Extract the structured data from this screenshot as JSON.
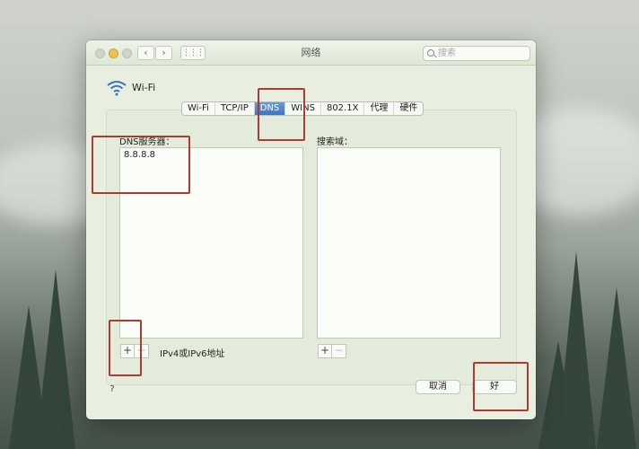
{
  "window": {
    "title": "网络",
    "search_placeholder": "搜索"
  },
  "nav": {
    "back_glyph": "‹",
    "forward_glyph": "›",
    "grid_glyph": "⋮⋮⋮"
  },
  "network": {
    "interface_name": "Wi-Fi"
  },
  "tabs": [
    {
      "label": "Wi-Fi",
      "active": false
    },
    {
      "label": "TCP/IP",
      "active": false
    },
    {
      "label": "DNS",
      "active": true
    },
    {
      "label": "WINS",
      "active": false
    },
    {
      "label": "802.1X",
      "active": false
    },
    {
      "label": "代理",
      "active": false
    },
    {
      "label": "硬件",
      "active": false
    }
  ],
  "dns": {
    "label": "DNS服务器：",
    "servers": [
      "8.8.8.8"
    ],
    "add_glyph": "+",
    "remove_glyph": "−",
    "hint": "IPv4或IPv6地址"
  },
  "search_domains": {
    "label": "搜索域：",
    "domains": [],
    "add_glyph": "+",
    "remove_glyph": "−"
  },
  "footer": {
    "help_glyph": "?",
    "cancel_label": "取消",
    "ok_label": "好"
  },
  "colors": {
    "accent": "#3f73c0",
    "annotation": "#b03a2e",
    "window_bg": "#e8efe0"
  }
}
